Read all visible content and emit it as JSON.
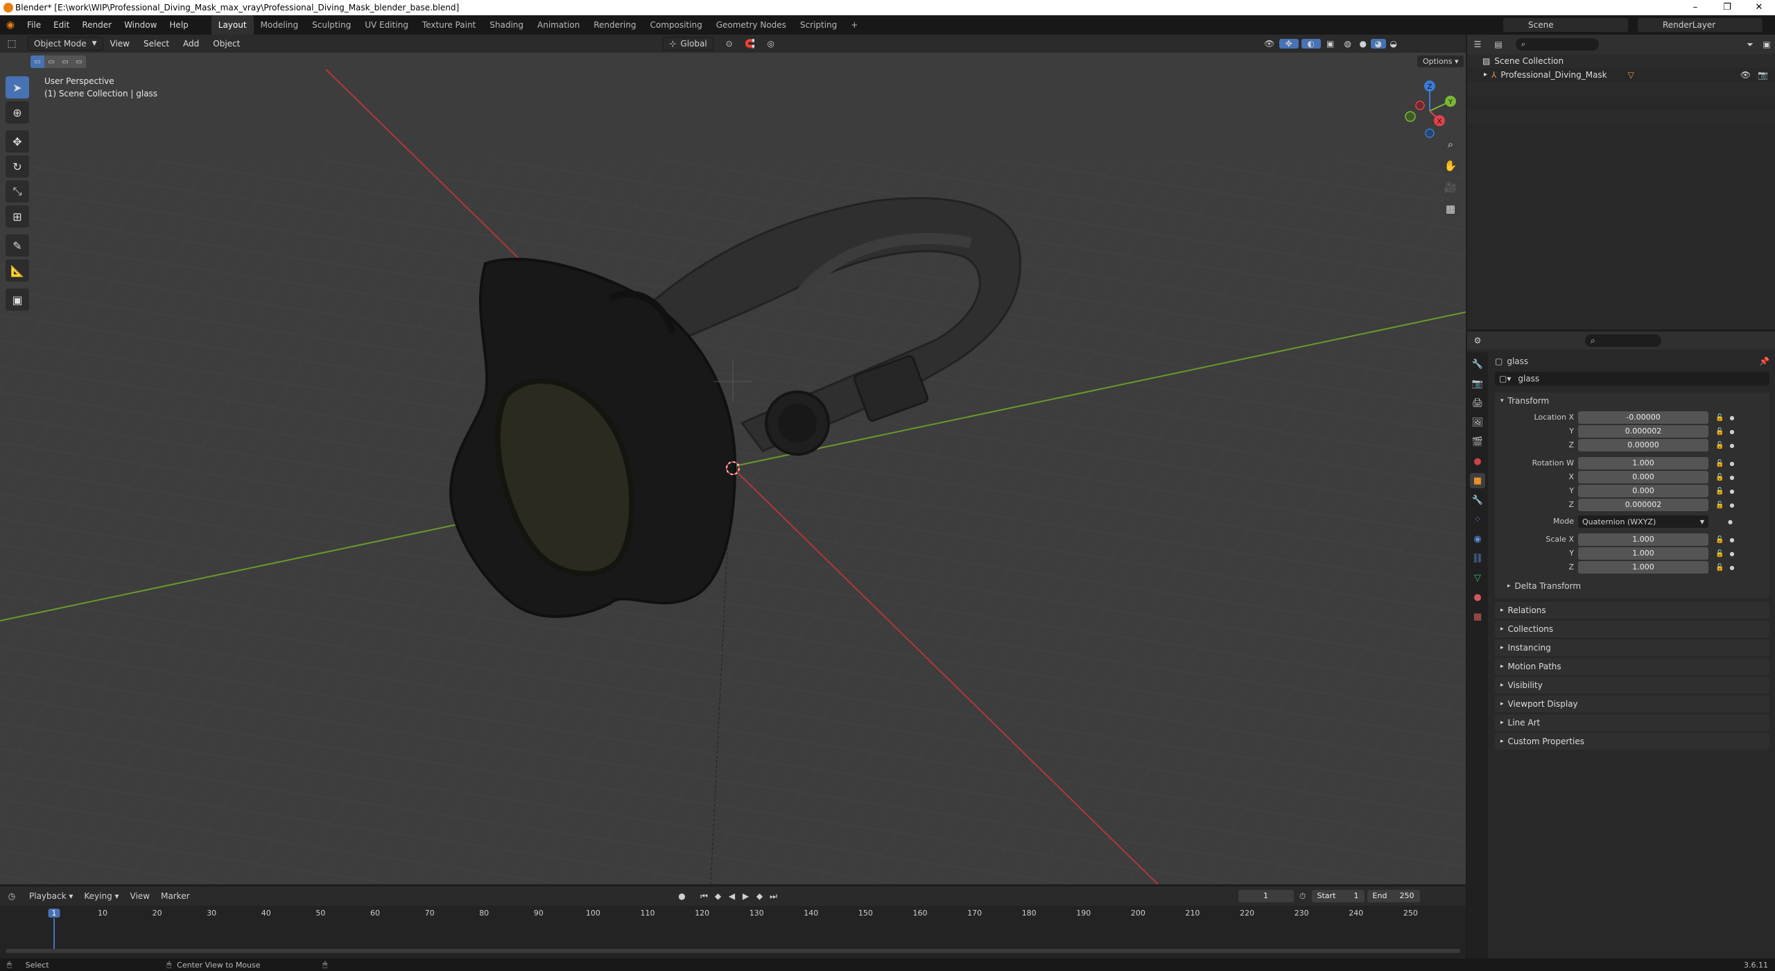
{
  "window": {
    "title": "Blender* [E:\\work\\WIP\\Professional_Diving_Mask_max_vray\\Professional_Diving_Mask_blender_base.blend]",
    "minimize": "–",
    "restore": "❐",
    "close": "✕"
  },
  "menu": [
    "File",
    "Edit",
    "Render",
    "Window",
    "Help"
  ],
  "workspaces": [
    "Layout",
    "Modeling",
    "Sculpting",
    "UV Editing",
    "Texture Paint",
    "Shading",
    "Animation",
    "Rendering",
    "Compositing",
    "Geometry Nodes",
    "Scripting",
    "+"
  ],
  "scene": {
    "label": "Scene",
    "render_layer": "RenderLayer"
  },
  "viewport": {
    "mode": "Object Mode",
    "menus": [
      "View",
      "Select",
      "Add",
      "Object"
    ],
    "orientation": "Global",
    "options": "Options",
    "perspective": "User Perspective",
    "collection_info": "(1) Scene Collection | glass",
    "gizmo": {
      "x": "X",
      "y": "Y",
      "z": "Z"
    },
    "colors": {
      "x_axis": "#b0383a",
      "y_axis": "#6a9a2a",
      "background": "#3d3d3d"
    }
  },
  "outliner": {
    "root": "Scene Collection",
    "items": [
      {
        "name": "Professional_Diving_Mask"
      }
    ]
  },
  "properties": {
    "object_name": "glass",
    "data_name": "glass",
    "transform_title": "Transform",
    "location": {
      "label": "Location X",
      "x": "-0.00000",
      "y_label": "Y",
      "y": "0.000002",
      "z_label": "Z",
      "z": "0.00000"
    },
    "rotation": {
      "label": "Rotation W",
      "w": "1.000",
      "x_label": "X",
      "x": "0.000",
      "y_label": "Y",
      "y": "0.000",
      "z_label": "Z",
      "z": "0.000002"
    },
    "mode": {
      "label": "Mode",
      "value": "Quaternion (WXYZ)"
    },
    "scale": {
      "label": "Scale X",
      "x": "1.000",
      "y_label": "Y",
      "y": "1.000",
      "z_label": "Z",
      "z": "1.000"
    },
    "delta": "Delta Transform",
    "panels": [
      "Relations",
      "Collections",
      "Instancing",
      "Motion Paths",
      "Visibility",
      "Viewport Display",
      "Line Art",
      "Custom Properties"
    ]
  },
  "timeline": {
    "menus": [
      "Playback",
      "Keying",
      "View",
      "Marker"
    ],
    "current_frame": "1",
    "start_label": "Start",
    "start": "1",
    "end_label": "End",
    "end": "250",
    "ticks": [
      "1",
      "10",
      "20",
      "30",
      "40",
      "50",
      "60",
      "70",
      "80",
      "90",
      "100",
      "110",
      "120",
      "130",
      "140",
      "150",
      "160",
      "170",
      "180",
      "190",
      "200",
      "210",
      "220",
      "230",
      "240",
      "250"
    ]
  },
  "status": {
    "select": "Select",
    "center": "Center View to Mouse",
    "version": "3.6.11"
  }
}
